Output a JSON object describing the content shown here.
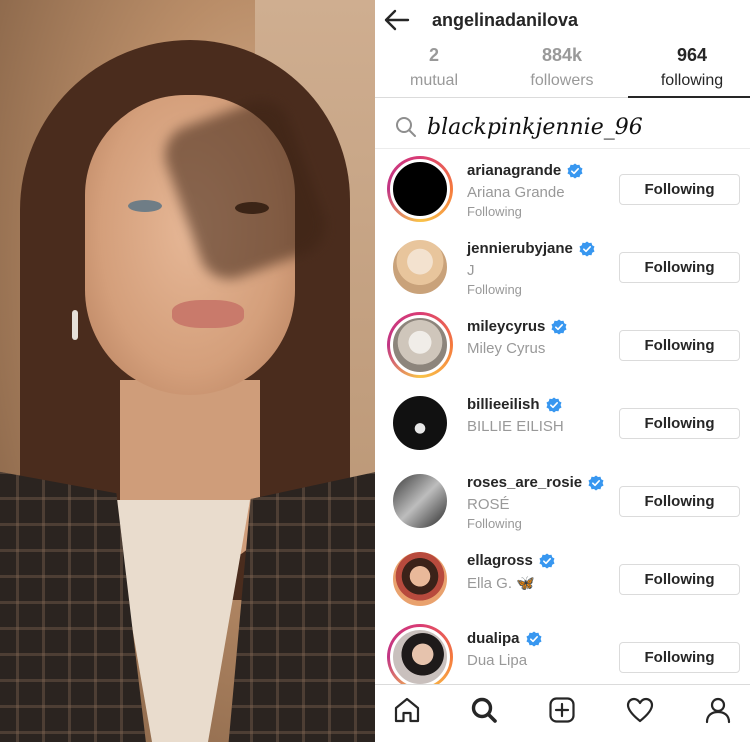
{
  "profile": {
    "username": "angelinadanilova"
  },
  "stats": [
    {
      "value": "2",
      "label": "mutual",
      "active": false
    },
    {
      "value": "884k",
      "label": "followers",
      "active": false
    },
    {
      "value": "964",
      "label": "following",
      "active": true
    }
  ],
  "search": {
    "value": "blackpinkjennie_96",
    "icon": "search-icon"
  },
  "following_list": [
    {
      "handle": "arianagrande",
      "name": "Ariana Grande",
      "sub": "Following",
      "verified": true,
      "button": "Following",
      "ring": "gradient"
    },
    {
      "handle": "jennierubyjane",
      "name": "J",
      "sub": "Following",
      "verified": true,
      "button": "Following",
      "ring": "plain"
    },
    {
      "handle": "mileycyrus",
      "name": "Miley Cyrus",
      "sub": "",
      "verified": true,
      "button": "Following",
      "ring": "gradient"
    },
    {
      "handle": "billieeilish",
      "name": "BILLIE EILISH",
      "sub": "",
      "verified": true,
      "button": "Following",
      "ring": "plain"
    },
    {
      "handle": "roses_are_rosie",
      "name": "ROSÉ",
      "sub": "Following",
      "verified": true,
      "button": "Following",
      "ring": "plain"
    },
    {
      "handle": "ellagross",
      "name": "Ella G. 🦋",
      "sub": "",
      "verified": true,
      "button": "Following",
      "ring": "plain"
    },
    {
      "handle": "dualipa",
      "name": "Dua Lipa",
      "sub": "",
      "verified": true,
      "button": "Following",
      "ring": "gradient"
    }
  ],
  "nav": [
    "home-icon",
    "search-icon",
    "add-post-icon",
    "heart-icon",
    "profile-icon"
  ],
  "colors": {
    "verified": "#3897f0",
    "text": "#262626",
    "muted": "#999999",
    "border": "#dbdbdb"
  }
}
